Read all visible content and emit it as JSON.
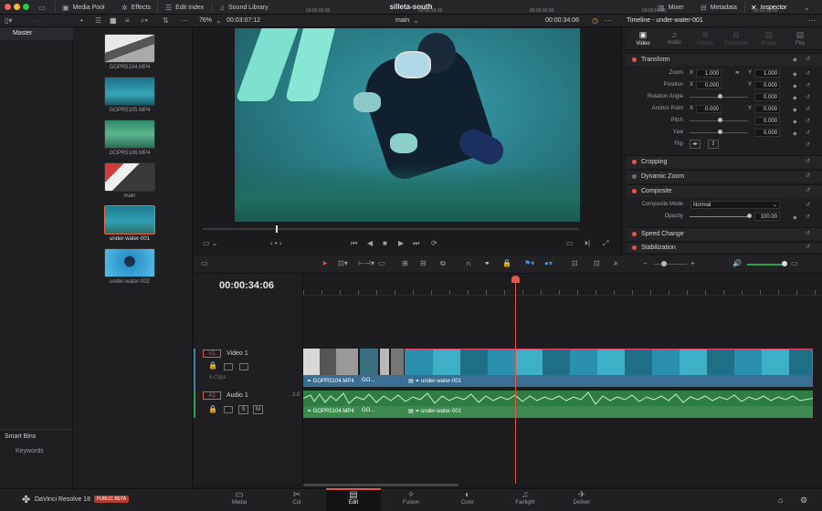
{
  "toolbar": {
    "media_pool": "Media Pool",
    "effects": "Effects",
    "edit_index": "Edit Index",
    "sound_library": "Sound Library",
    "project_title": "silleta-south",
    "mixer": "Mixer",
    "metadata": "Metadata",
    "inspector": "Inspector"
  },
  "viewer": {
    "zoom": "76%",
    "source_timecode": "00:03:07:12",
    "timeline_name": "main",
    "timecode": "00:00:34:06"
  },
  "bins": {
    "master": "Master",
    "smart_bins": "Smart Bins",
    "keywords": "Keywords"
  },
  "clips": [
    {
      "name": "GOPR5104.MP4"
    },
    {
      "name": "GOPR5105.MP4"
    },
    {
      "name": "GOPR5106.MP4"
    },
    {
      "name": "main"
    },
    {
      "name": "under-water-001"
    },
    {
      "name": "under-water-002"
    }
  ],
  "inspector": {
    "title": "Timeline - under-water-001",
    "tabs": [
      "Video",
      "Audio",
      "Effects",
      "Transition",
      "Image",
      "File"
    ],
    "transform": "Transform",
    "zoom_label": "Zoom",
    "position_label": "Position",
    "rotation_label": "Rotation Angle",
    "anchor_label": "Anchor Point",
    "pitch_label": "Pitch",
    "yaw_label": "Yaw",
    "flip_label": "Flip",
    "x": "X",
    "y": "Y",
    "zoom_x": "1.000",
    "zoom_y": "1.000",
    "pos_x": "0.000",
    "pos_y": "0.000",
    "rotation": "0.000",
    "anchor_x": "0.000",
    "anchor_y": "0.000",
    "pitch": "0.000",
    "yaw": "0.000",
    "cropping": "Cropping",
    "dynamic_zoom": "Dynamic Zoom",
    "composite": "Composite",
    "composite_mode_label": "Composite Mode",
    "composite_mode": "Normal",
    "opacity_label": "Opacity",
    "opacity": "100.00",
    "speed_change": "Speed Change",
    "stabilization": "Stabilization"
  },
  "timeline": {
    "timecode": "00:00:34:06",
    "ruler": [
      "00:00:00:00",
      "00:00:18:00",
      "00:00:36:00",
      "00:00:54:00",
      "00:01:12:00"
    ],
    "video_track_id": "V1",
    "video_track_name": "Video 1",
    "video_clip_count": "6 Clips",
    "audio_track_id": "A1",
    "audio_track_name": "Audio 1",
    "audio_channels": "2.0",
    "clip_a": "GOPR5104.MP4",
    "clip_b": "GO...",
    "clip_main": "under-water-001",
    "audio_s": "S",
    "audio_m": "M"
  },
  "pages": [
    "Media",
    "Cut",
    "Edit",
    "Fusion",
    "Color",
    "Fairlight",
    "Deliver"
  ],
  "app": {
    "name": "DaVinci Resolve 18",
    "badge": "PUBLIC BETA"
  },
  "colors": {
    "accent": "#e0584a",
    "audio_track": "#2e7d43",
    "video_track": "#3a83a8"
  }
}
